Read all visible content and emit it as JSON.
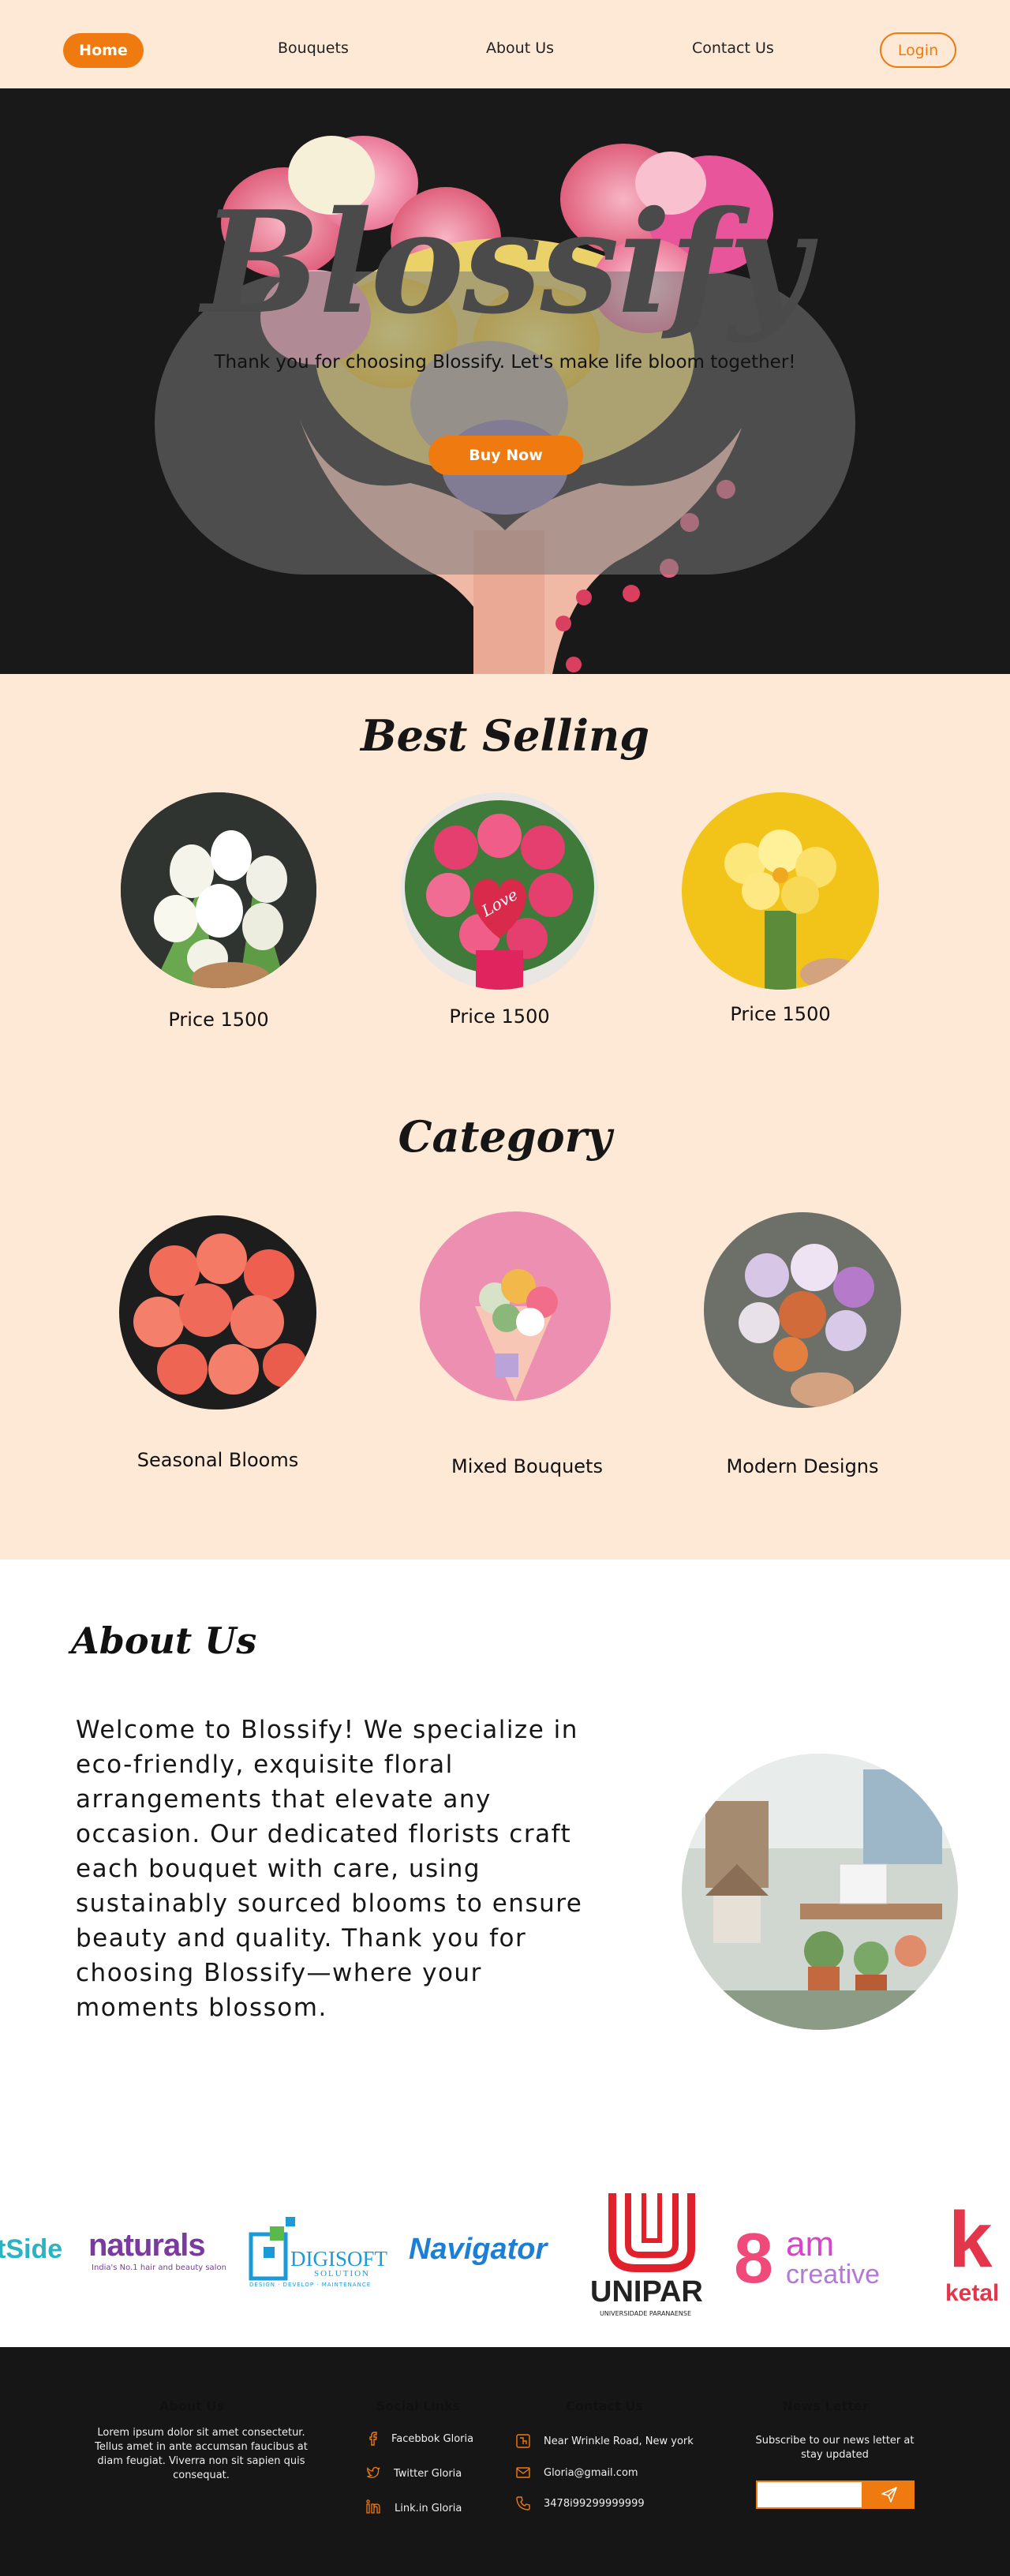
{
  "nav": {
    "home": "Home",
    "links": [
      "Bouquets",
      "About Us",
      "Contact Us"
    ],
    "login": "Login"
  },
  "hero": {
    "title": "Blossify",
    "subtitle": "Thank you for choosing Blossify. Let's make life bloom together!",
    "button": "Buy Now"
  },
  "best_selling": {
    "title": "Best Selling",
    "items": [
      {
        "price": "Price 1500",
        "image": "white-tulips-bouquet"
      },
      {
        "price": "Price 1500",
        "image": "pink-roses-love-heart-bouquet"
      },
      {
        "price": "Price 1500",
        "image": "yellow-daffodils-bouquet"
      }
    ]
  },
  "category": {
    "title": "Category",
    "items": [
      {
        "label": "Seasonal Blooms",
        "image": "coral-roses"
      },
      {
        "label": "Mixed Bouquets",
        "image": "mixed-bouquet-pink"
      },
      {
        "label": "Modern Designs",
        "image": "modern-dahlia-bouquet"
      }
    ]
  },
  "about": {
    "title": "About Us",
    "text": "Welcome to Blossify! We specialize in eco-friendly, exquisite floral arrangements that elevate any occasion. Our dedicated florists craft each bouquet with care, using sustainably sourced blooms to ensure beauty and quality. Thank you for choosing Blossify—where your moments blossom.",
    "image": "flower-shop-interior"
  },
  "logos": {
    "tside": "tSide",
    "naturals": "naturals",
    "naturals_tag": "India's No.1 hair and beauty salon",
    "digisoft": "DIGISOFT",
    "digisoft_sub": "SOLUTION",
    "digisoft_tag": "DESIGN · DEVELOP · MAINTENANCE",
    "navigator": "Navigator",
    "unipar": "UNIPAR",
    "unipar_tag": "UNIVERSIDADE PARANAENSE",
    "eightam_num": "8",
    "eightam_am": "am",
    "eightam_creative": "creative",
    "ketal_k": "k",
    "ketal": "ketal"
  },
  "footer": {
    "about": {
      "heading": "About Us",
      "text": "Lorem ipsum dolor sit amet consectetur. Tellus amet in ante accumsan faucibus at diam feugiat. Viverra non sit sapien quis consequat."
    },
    "social": {
      "heading": "Social Links",
      "items": [
        "Facebbok Gloria",
        "Twitter Gloria",
        "Link.in Gloria"
      ]
    },
    "contact": {
      "heading": "Contact Us",
      "items": [
        "Near Wrinkle Road, New york",
        "Gloria@gmail.com",
        "3478i99299999999"
      ]
    },
    "newsletter": {
      "heading": "News Letter",
      "text": "Subscribe to our news letter at stay updated",
      "placeholder": ""
    }
  },
  "colors": {
    "accent": "#ef7a10",
    "cream": "#fde9d5",
    "dark": "#161616"
  }
}
